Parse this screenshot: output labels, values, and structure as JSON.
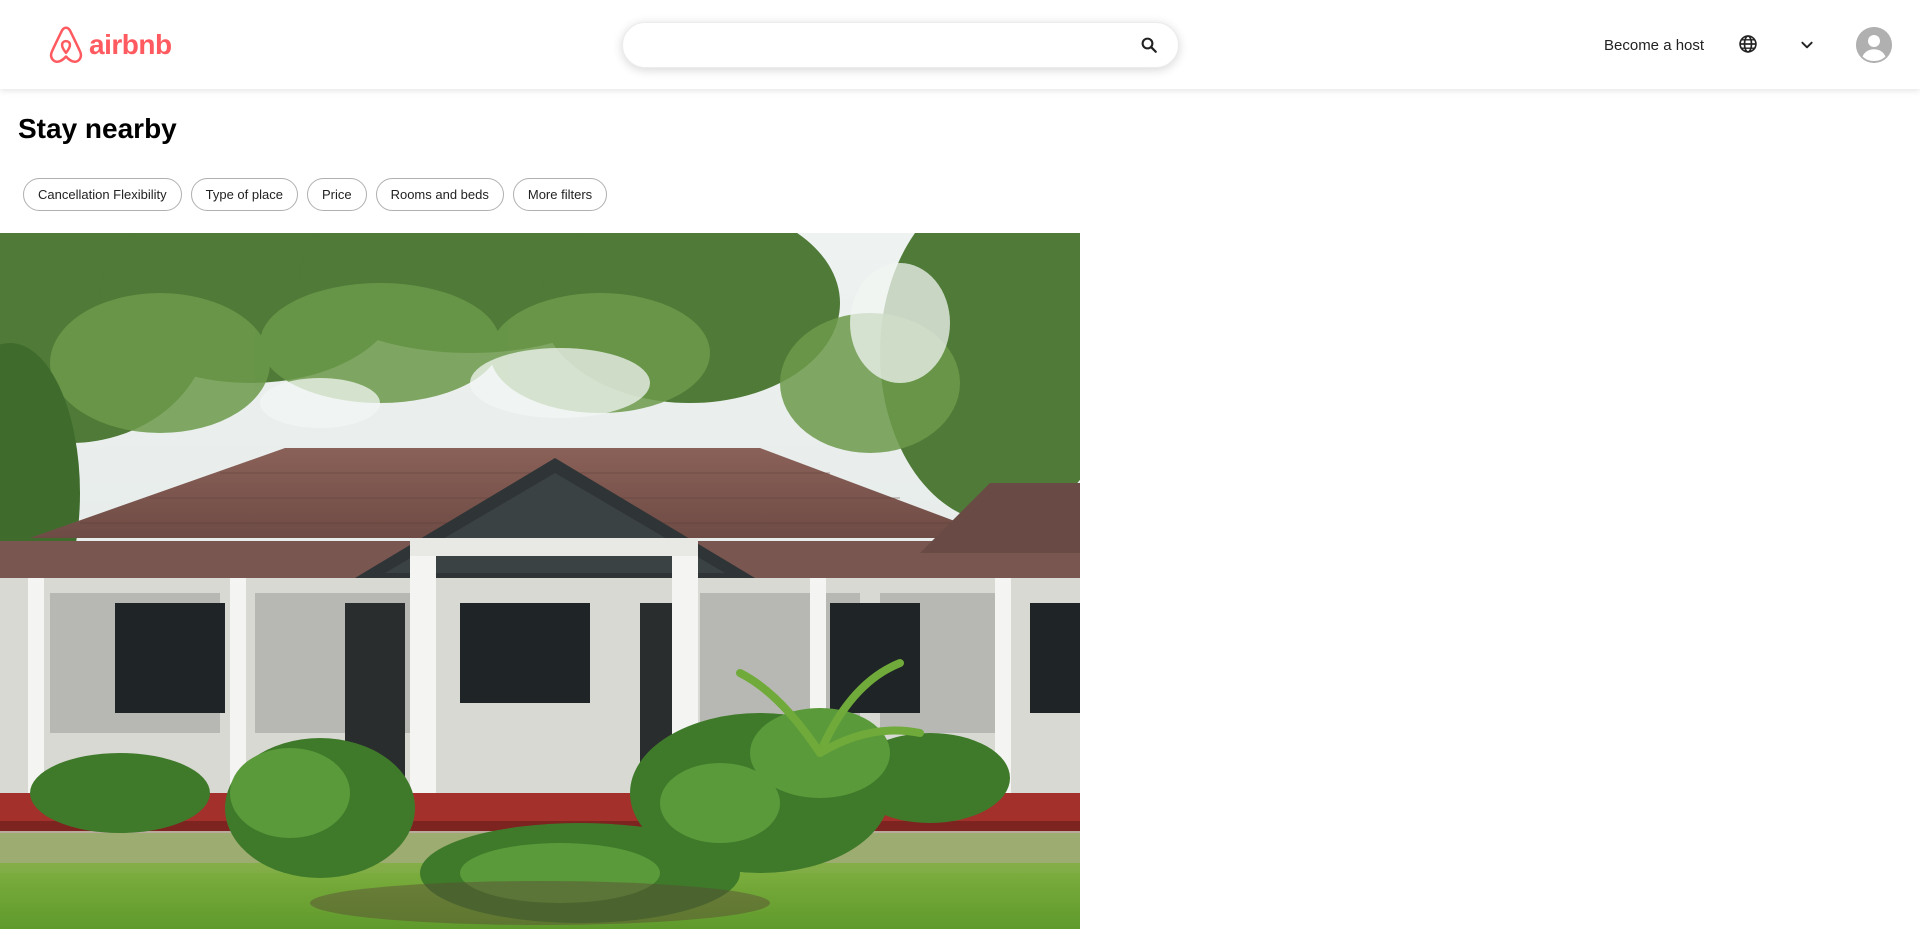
{
  "header": {
    "logo_text": "airbnb",
    "search": {
      "value": "",
      "placeholder": ""
    },
    "become_host": "Become a host"
  },
  "main": {
    "title": "Stay nearby",
    "filters": [
      {
        "label": "Cancellation Flexibility"
      },
      {
        "label": "Type of place"
      },
      {
        "label": "Price"
      },
      {
        "label": "Rooms and beds"
      },
      {
        "label": "More filters"
      }
    ]
  },
  "icons": {
    "brand": "airbnb-logo-icon",
    "search": "search-icon",
    "language": "globe-icon",
    "menu": "chevron-down-icon",
    "profile": "user-avatar-icon"
  },
  "colors": {
    "brand": "#FF5A5F",
    "text": "#222222",
    "border": "#b0b0b0",
    "avatar": "#b0b0b0"
  }
}
